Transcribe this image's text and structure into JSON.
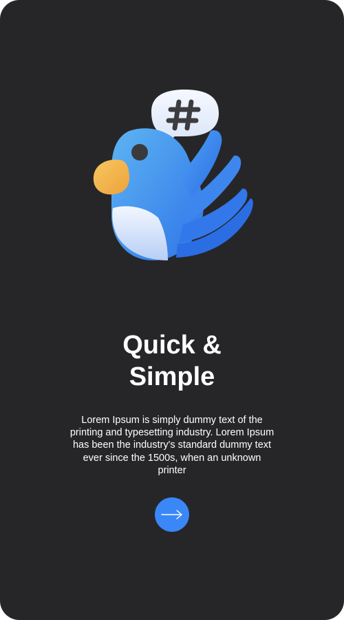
{
  "onboarding": {
    "title_line1": "Quick &",
    "title_line2": "Simple",
    "description": "Lorem Ipsum is simply dummy text of the printing and typesetting industry. Lorem Ipsum has been the industry's standard dummy text ever since the 1500s, when an unknown printer",
    "next_icon": "arrow-right-icon",
    "illustration_icon": "bird-hashtag-icon",
    "illustration_badge_text": "#"
  },
  "colors": {
    "background": "#262628",
    "accent": "#3a87f7",
    "text": "#ffffff"
  }
}
